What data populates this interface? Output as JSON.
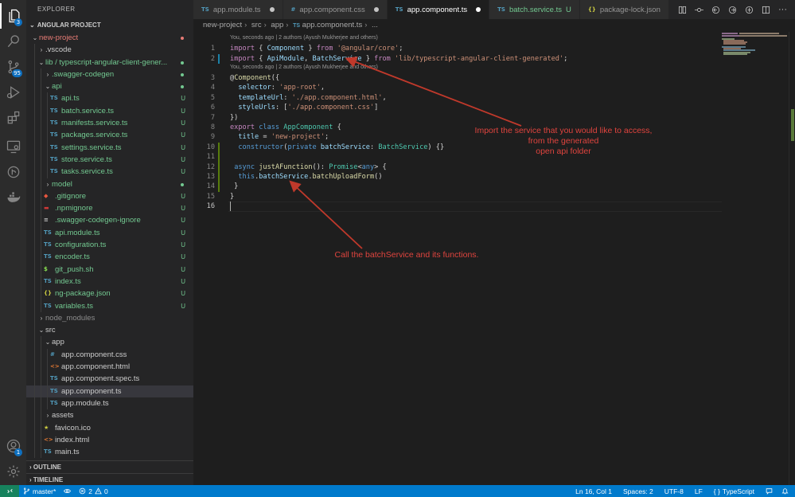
{
  "activity": {
    "source_control_badge": "95",
    "accounts_badge": "1",
    "explorer_badge": "3"
  },
  "sidebar": {
    "title": "EXPLORER",
    "section": "ANGULAR PROJECT",
    "outline": "OUTLINE",
    "timeline": "TIMELINE",
    "tree": [
      {
        "label": "new-project",
        "depth": 0,
        "kind": "folder-open",
        "color": "#e67b75",
        "marker": "dot"
      },
      {
        "label": ".vscode",
        "depth": 1,
        "kind": "folder",
        "color": "#cccccc"
      },
      {
        "label": "lib / typescript-angular-client-gener...",
        "depth": 1,
        "kind": "folder-open",
        "color": "#73c991",
        "marker": "dot-green"
      },
      {
        "label": ".swagger-codegen",
        "depth": 2,
        "kind": "folder",
        "color": "#73c991",
        "marker": "dot-green"
      },
      {
        "label": "api",
        "depth": 2,
        "kind": "folder-open",
        "color": "#73c991",
        "marker": "dot-green"
      },
      {
        "label": "api.ts",
        "depth": 3,
        "kind": "ts",
        "color": "#73c991",
        "status": "U"
      },
      {
        "label": "batch.service.ts",
        "depth": 3,
        "kind": "ts",
        "color": "#73c991",
        "status": "U"
      },
      {
        "label": "manifests.service.ts",
        "depth": 3,
        "kind": "ts",
        "color": "#73c991",
        "status": "U"
      },
      {
        "label": "packages.service.ts",
        "depth": 3,
        "kind": "ts",
        "color": "#73c991",
        "status": "U"
      },
      {
        "label": "settings.service.ts",
        "depth": 3,
        "kind": "ts",
        "color": "#73c991",
        "status": "U"
      },
      {
        "label": "store.service.ts",
        "depth": 3,
        "kind": "ts",
        "color": "#73c991",
        "status": "U"
      },
      {
        "label": "tasks.service.ts",
        "depth": 3,
        "kind": "ts",
        "color": "#73c991",
        "status": "U"
      },
      {
        "label": "model",
        "depth": 2,
        "kind": "folder",
        "color": "#73c991",
        "marker": "dot-green"
      },
      {
        "label": ".gitignore",
        "depth": 2,
        "kind": "git",
        "color": "#73c991",
        "status": "U"
      },
      {
        "label": ".npmignore",
        "depth": 2,
        "kind": "npm",
        "color": "#73c991",
        "status": "U"
      },
      {
        "label": ".swagger-codegen-ignore",
        "depth": 2,
        "kind": "txt",
        "color": "#73c991",
        "status": "U"
      },
      {
        "label": "api.module.ts",
        "depth": 2,
        "kind": "ts",
        "color": "#73c991",
        "status": "U"
      },
      {
        "label": "configuration.ts",
        "depth": 2,
        "kind": "ts",
        "color": "#73c991",
        "status": "U"
      },
      {
        "label": "encoder.ts",
        "depth": 2,
        "kind": "ts",
        "color": "#73c991",
        "status": "U"
      },
      {
        "label": "git_push.sh",
        "depth": 2,
        "kind": "sh",
        "color": "#73c991",
        "status": "U"
      },
      {
        "label": "index.ts",
        "depth": 2,
        "kind": "ts",
        "color": "#73c991",
        "status": "U"
      },
      {
        "label": "ng-package.json",
        "depth": 2,
        "kind": "json",
        "color": "#73c991",
        "status": "U"
      },
      {
        "label": "variables.ts",
        "depth": 2,
        "kind": "ts",
        "color": "#73c991",
        "status": "U"
      },
      {
        "label": "node_modules",
        "depth": 1,
        "kind": "folder",
        "color": "#8c8c8c"
      },
      {
        "label": "src",
        "depth": 1,
        "kind": "folder-open",
        "color": "#cccccc"
      },
      {
        "label": "app",
        "depth": 2,
        "kind": "folder-open",
        "color": "#cccccc"
      },
      {
        "label": "app.component.css",
        "depth": 3,
        "kind": "css",
        "color": "#cccccc"
      },
      {
        "label": "app.component.html",
        "depth": 3,
        "kind": "html",
        "color": "#cccccc"
      },
      {
        "label": "app.component.spec.ts",
        "depth": 3,
        "kind": "ts",
        "color": "#cccccc"
      },
      {
        "label": "app.component.ts",
        "depth": 3,
        "kind": "ts",
        "color": "#cccccc",
        "selected": true
      },
      {
        "label": "app.module.ts",
        "depth": 3,
        "kind": "ts",
        "color": "#cccccc"
      },
      {
        "label": "assets",
        "depth": 2,
        "kind": "folder",
        "color": "#cccccc"
      },
      {
        "label": "favicon.ico",
        "depth": 2,
        "kind": "star",
        "color": "#cccccc"
      },
      {
        "label": "index.html",
        "depth": 2,
        "kind": "html",
        "color": "#cccccc"
      },
      {
        "label": "main.ts",
        "depth": 2,
        "kind": "ts",
        "color": "#cccccc"
      }
    ]
  },
  "tabs": [
    {
      "label": "app.module.ts",
      "icon": "TS",
      "icon_color": "#519aba",
      "modified": true
    },
    {
      "label": "app.component.css",
      "icon": "#",
      "icon_color": "#519aba",
      "modified": true
    },
    {
      "label": "app.component.ts",
      "icon": "TS",
      "icon_color": "#519aba",
      "modified": true,
      "active": true
    },
    {
      "label": "batch.service.ts",
      "icon": "TS",
      "icon_color": "#519aba",
      "suffix": "U",
      "label_color": "#73c991"
    },
    {
      "label": "package-lock.json",
      "icon": "{}",
      "icon_color": "#cbcb41"
    }
  ],
  "breadcrumb": [
    "new-project",
    "src",
    "app",
    "app.component.ts",
    "..."
  ],
  "editor": {
    "codelens": "You, seconds ago | 2 authors (Ayush Mukherjee and others)",
    "lines": [
      {
        "n": "1",
        "t": [
          [
            "k1",
            "import"
          ],
          [
            "pc",
            " { "
          ],
          [
            "vr",
            "Component"
          ],
          [
            "pc",
            " } "
          ],
          [
            "k1",
            "from"
          ],
          [
            "pc",
            " "
          ],
          [
            "st",
            "'@angular/core'"
          ],
          [
            "pc",
            ";"
          ]
        ]
      },
      {
        "n": "2",
        "t": [
          [
            "k1",
            "import"
          ],
          [
            "pc",
            " { "
          ],
          [
            "vr",
            "ApiModule"
          ],
          [
            "pc",
            ", "
          ],
          [
            "vr",
            "BatchService"
          ],
          [
            "pc",
            " } "
          ],
          [
            "k1",
            "from"
          ],
          [
            "pc",
            " "
          ],
          [
            "st",
            "'lib/typescript-angular-client-generated'"
          ],
          [
            "pc",
            ";"
          ]
        ]
      },
      {
        "n": "3",
        "t": [
          [
            "pc",
            "@"
          ],
          [
            "fn",
            "Component"
          ],
          [
            "pc",
            "({"
          ]
        ]
      },
      {
        "n": "4",
        "t": [
          [
            "pc",
            "  "
          ],
          [
            "vr",
            "selector"
          ],
          [
            "pc",
            ": "
          ],
          [
            "st",
            "'app-root'"
          ],
          [
            "pc",
            ","
          ]
        ]
      },
      {
        "n": "5",
        "t": [
          [
            "pc",
            "  "
          ],
          [
            "vr",
            "templateUrl"
          ],
          [
            "pc",
            ": "
          ],
          [
            "st",
            "'./app.component.html'"
          ],
          [
            "pc",
            ","
          ]
        ]
      },
      {
        "n": "6",
        "t": [
          [
            "pc",
            "  "
          ],
          [
            "vr",
            "styleUrls"
          ],
          [
            "pc",
            ": ["
          ],
          [
            "st",
            "'./app.component.css'"
          ],
          [
            "pc",
            "]"
          ]
        ]
      },
      {
        "n": "7",
        "t": [
          [
            "pc",
            "})"
          ]
        ]
      },
      {
        "n": "8",
        "t": [
          [
            "k1",
            "export"
          ],
          [
            "pc",
            " "
          ],
          [
            "k2",
            "class"
          ],
          [
            "pc",
            " "
          ],
          [
            "ty",
            "AppComponent"
          ],
          [
            "pc",
            " {"
          ]
        ]
      },
      {
        "n": "9",
        "t": [
          [
            "pc",
            "  "
          ],
          [
            "vr",
            "title"
          ],
          [
            "pc",
            " = "
          ],
          [
            "st",
            "'new-project'"
          ],
          [
            "pc",
            ";"
          ]
        ]
      },
      {
        "n": "10",
        "t": [
          [
            "pc",
            "  "
          ],
          [
            "k2",
            "constructor"
          ],
          [
            "pc",
            "("
          ],
          [
            "k2",
            "private"
          ],
          [
            "pc",
            " "
          ],
          [
            "vr",
            "batchService"
          ],
          [
            "pc",
            ": "
          ],
          [
            "ty",
            "BatchService"
          ],
          [
            "pc",
            ") {}"
          ]
        ]
      },
      {
        "n": "11",
        "t": []
      },
      {
        "n": "12",
        "t": [
          [
            "pc",
            " "
          ],
          [
            "k2",
            "async"
          ],
          [
            "pc",
            " "
          ],
          [
            "fn",
            "justAFunction"
          ],
          [
            "pc",
            "(): "
          ],
          [
            "ty",
            "Promise"
          ],
          [
            "pc",
            "<"
          ],
          [
            "k2",
            "any"
          ],
          [
            "pc",
            "> {"
          ]
        ]
      },
      {
        "n": "13",
        "t": [
          [
            "pc",
            "  "
          ],
          [
            "k2",
            "this"
          ],
          [
            "pc",
            "."
          ],
          [
            "vr",
            "batchService"
          ],
          [
            "pc",
            "."
          ],
          [
            "fn",
            "batchUploadForm"
          ],
          [
            "pc",
            "()"
          ]
        ]
      },
      {
        "n": "14",
        "t": [
          [
            "pc",
            " }"
          ]
        ]
      },
      {
        "n": "15",
        "t": [
          [
            "pc",
            "}"
          ]
        ]
      },
      {
        "n": "16",
        "t": []
      }
    ],
    "annotation_import": "Import the service that you would like to access,\nfrom the generated\nopen api folder",
    "annotation_call": "Call the batchService and its functions."
  },
  "colors": {
    "annotation_red": "#e0443e",
    "status_bar": "#007acc",
    "remote": "#16825d"
  },
  "status": {
    "branch": "master*",
    "errors": "2",
    "warnings": "0",
    "position": "Ln 16, Col 1",
    "spaces": "Spaces: 2",
    "encoding": "UTF-8",
    "eol": "LF",
    "braces": "{ }",
    "language": "TypeScript"
  }
}
